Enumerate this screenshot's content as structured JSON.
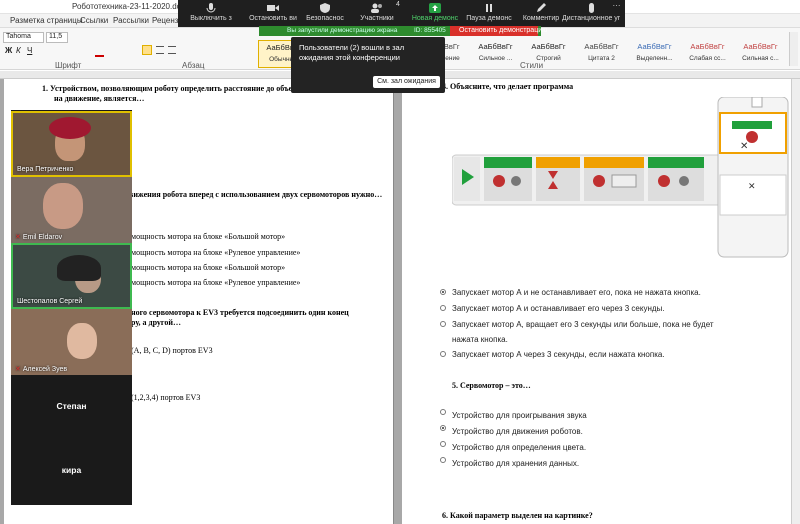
{
  "window": {
    "title": "Робототехника-23-11-2020.docx - Micro",
    "search_hint": "Си"
  },
  "menu": [
    "Разметка страницы",
    "Ссылки",
    "Рассылки",
    "Рецензиро"
  ],
  "ribbon": {
    "font_name": "Tahoma",
    "font_size": "11,5",
    "group_font": "Шрифт",
    "group_paragraph": "Абзац",
    "group_styles": "Стили",
    "styles": [
      {
        "sample": "АаБбВвГг",
        "name": "Обычный"
      },
      {
        "sample": "АаБбВвГ",
        "name": "Подзагол..."
      },
      {
        "sample": "АаБбВвГ",
        "name": "Слабое в..."
      },
      {
        "sample": "АаБбВвГг",
        "name": "Выделение"
      },
      {
        "sample": "АаБбВвГг",
        "name": "Сильное ..."
      },
      {
        "sample": "АаБбВвГг",
        "name": "Строгий"
      },
      {
        "sample": "АаБбВвГг",
        "name": "Цитата 2"
      },
      {
        "sample": "АаБбВвГг",
        "name": "Выделенн..."
      },
      {
        "sample": "АаБбВвГг",
        "name": "Слабая сс..."
      },
      {
        "sample": "АаБбВвГг",
        "name": "Сильная с..."
      }
    ]
  },
  "zoom_toolbar": {
    "buttons": [
      {
        "label": "Выключить з",
        "icon": "mic-icon"
      },
      {
        "label": "Остановить ви",
        "icon": "video-icon"
      },
      {
        "label": "Безопаснос",
        "icon": "shield-icon"
      },
      {
        "label": "Участники",
        "icon": "participants-icon",
        "badge": "4"
      },
      {
        "label": "Новая демонс",
        "icon": "share-icon"
      },
      {
        "label": "Пауза демонс",
        "icon": "pause-icon"
      },
      {
        "label": "Комментир",
        "icon": "annotate-icon"
      },
      {
        "label": "Дистанционное уп",
        "icon": "remote-icon"
      },
      {
        "label": "Еще",
        "icon": "more-icon"
      }
    ],
    "sharing_text": "Вы запустили демонстрацию экрана",
    "sharing_id": "ID: 855405",
    "stop_label": "Остановить демонстрацию"
  },
  "waiting_popup": {
    "message": "Пользователи (2) вошли в зал ожидания этой конференции",
    "button": "См. зал ожидания"
  },
  "participants": [
    {
      "name": "Вера Петриченко",
      "muted": false
    },
    {
      "name": "Emil Eldarov",
      "muted": true
    },
    {
      "name": "Шестопалов Сергей",
      "muted": false
    },
    {
      "name": "Алексей Зуев",
      "muted": true
    },
    {
      "name": "Степан",
      "muted": false
    },
    {
      "name": "кира",
      "muted": false
    }
  ],
  "left_page": {
    "q1": "1.    Устройством, позволяющим роботу определить расстояние до объе",
    "q1b": "на движение, является…",
    "q2": "вижения робота вперед с использованием двух сервомоторов нужно…",
    "opts2": [
      "мощность мотора на блоке «Большой мотор»",
      "мощность мотора на блоке «Рулевое управление»",
      "мощность мотора на блоке «Большой мотор»",
      "мощность мотора на блоке «Рулевое управление»"
    ],
    "q3": "ного сервомотора к EV3 требуется подсоединить один конец",
    "q3b": "ру, а другой…",
    "opt3a": "(A, B, C, D) портов EV3",
    "opt3b": "(1,2,3,4) портов EV3"
  },
  "right_page": {
    "q4": "4.   Объясните, что делает программа",
    "answers4": [
      {
        "text": "Запускает мотор А и не останавливает его, пока не нажата кнопка.",
        "checked": true
      },
      {
        "text": "Запускает мотор А и останавливает его через 3 секунды.",
        "checked": false
      },
      {
        "text": "Запускает мотор А, вращает его 3 секунды или больше, пока не будет",
        "text2": "нажата кнопка.",
        "checked": false
      },
      {
        "text": "Запускает мотор А через 3 секунды, если нажата кнопка.",
        "checked": false
      }
    ],
    "q5": "5.    Сервомотор – это…",
    "answers5": [
      {
        "text": "Устройство для проигрывания звука",
        "checked": false
      },
      {
        "text": "Устройство для движения  роботов.",
        "checked": true
      },
      {
        "text": "Устройство для определения цвета.",
        "checked": false
      },
      {
        "text": "Устройство для хранения данных.",
        "checked": false
      }
    ],
    "q6": "6.     Какой параметр выделен на картинке?"
  },
  "colors": {
    "zoom_bg": "#1f1f1f",
    "share_green": "#2e8b2e",
    "stop_red": "#d9302a",
    "new_share_green": "#25a244"
  }
}
